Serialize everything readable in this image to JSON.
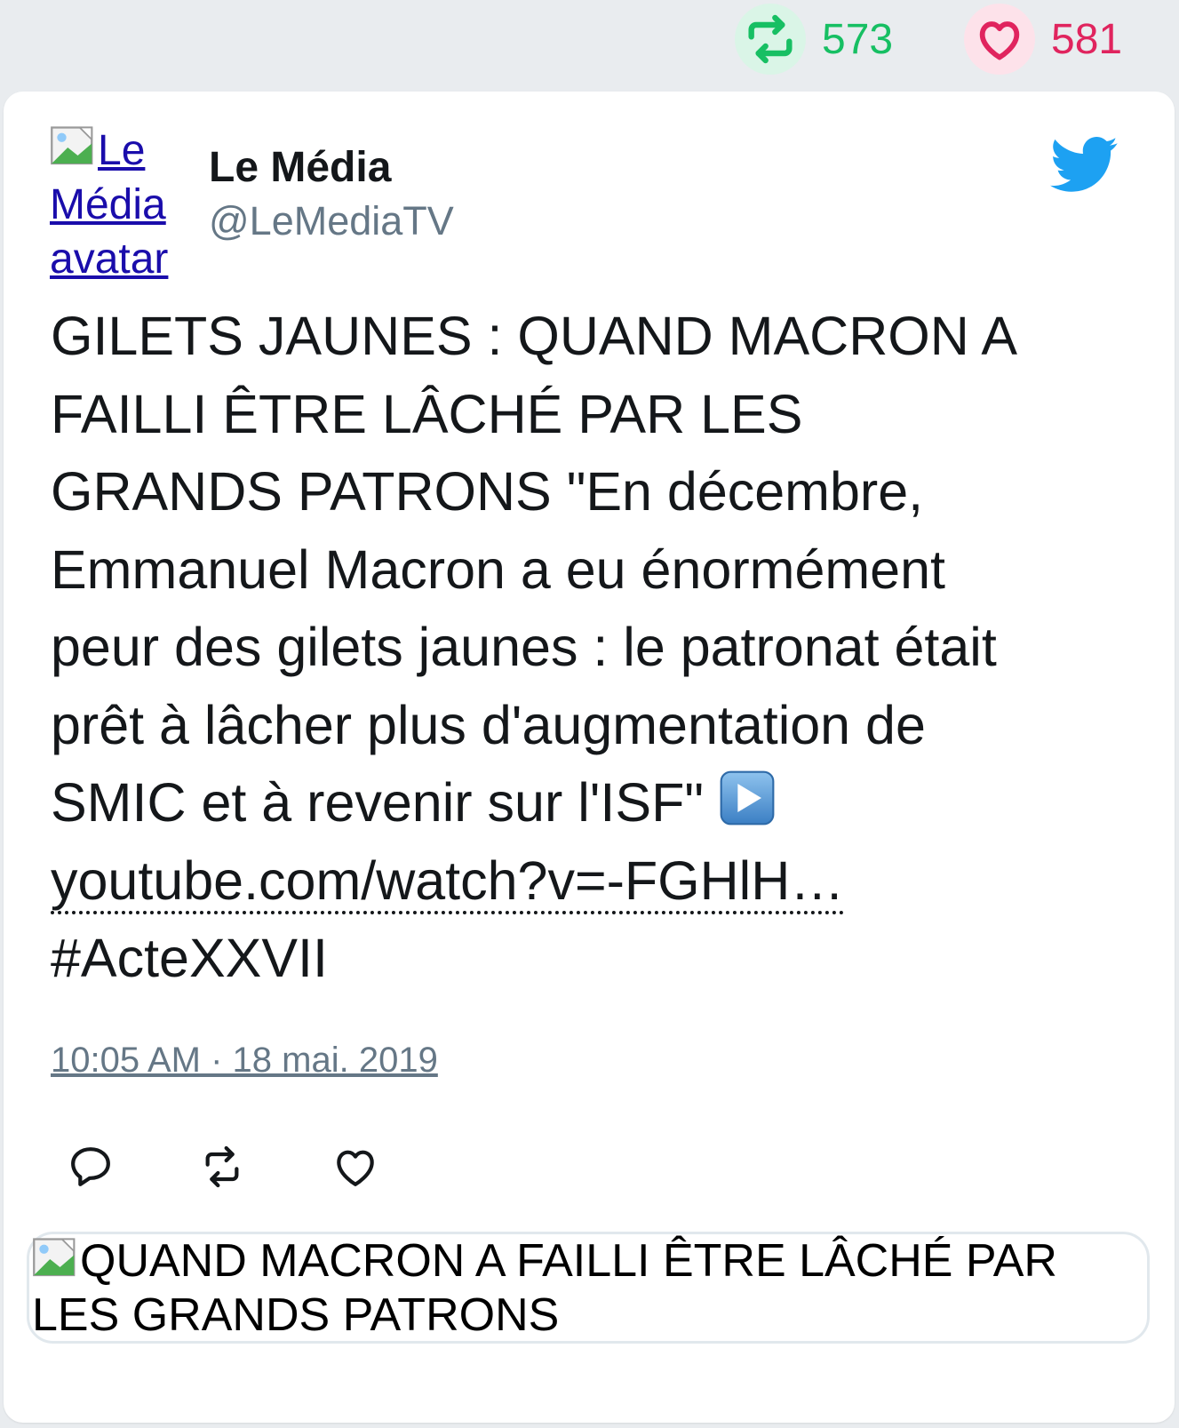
{
  "stats": {
    "retweets": "573",
    "likes": "581"
  },
  "author": {
    "avatar_alt": "Le Média avatar",
    "name": "Le Média",
    "handle": "@LeMediaTV"
  },
  "tweet": {
    "lines": [
      "GILETS JAUNES : QUAND MACRON A",
      "FAILLI ÊTRE LÂCHÉ PAR LES",
      "GRANDS PATRONS \"En décembre,",
      "Emmanuel Macron a eu énormément",
      "peur des gilets jaunes : le patronat était",
      "prêt à lâcher plus d'augmentation de",
      "SMIC et à revenir sur l'ISF\" "
    ],
    "link": "youtube.com/watch?v=-FGHlH…",
    "hashtag": "#ActeXXVII",
    "timestamp": "10:05 AM · 18 mai. 2019"
  },
  "preview": {
    "title": "QUAND MACRON A FAILLI ÊTRE LÂCHÉ PAR LES GRANDS PATRONS"
  },
  "icons": {
    "retweet": "retweet-icon",
    "like": "heart-icon",
    "reply": "reply-icon",
    "bird": "twitter-bird-icon",
    "play": "play-button-emoji"
  },
  "colors": {
    "retweet": "#17bf63",
    "like": "#e0245e",
    "twitter_blue": "#1da1f2",
    "handle_gray": "#657786"
  }
}
